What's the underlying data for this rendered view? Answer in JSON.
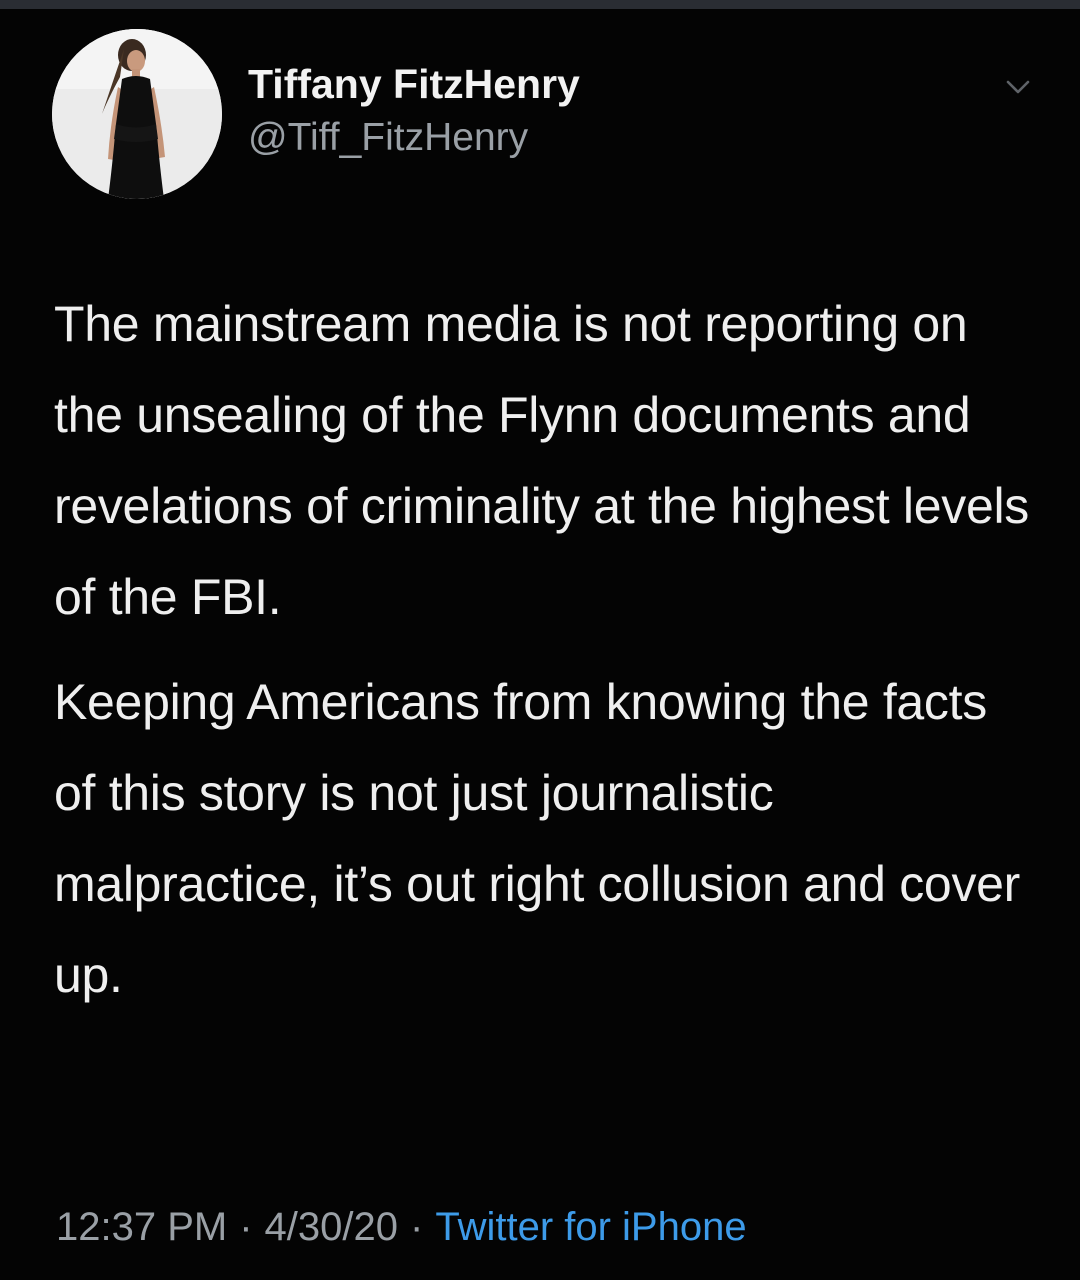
{
  "colors": {
    "background": "#040404",
    "text_primary": "#efefef",
    "text_secondary": "#9aa0a6",
    "link": "#3d9be9"
  },
  "author": {
    "display_name": "Tiffany FitzHenry",
    "handle": "@Tiff_FitzHenry",
    "avatar_icon": "profile-photo-avatar"
  },
  "menu": {
    "icon": "chevron-down-icon"
  },
  "tweet": {
    "paragraphs": [
      "The mainstream media is not reporting on the unsealing of the Flynn documents and revelations of criminality at the highest levels of the FBI.",
      "Keeping Americans from knowing the facts of this story is not just journalistic malpractice, it’s out right collusion and cover up."
    ]
  },
  "meta": {
    "time": "12:37 PM",
    "date": "4/30/20",
    "separator": "·",
    "source": "Twitter for iPhone"
  }
}
